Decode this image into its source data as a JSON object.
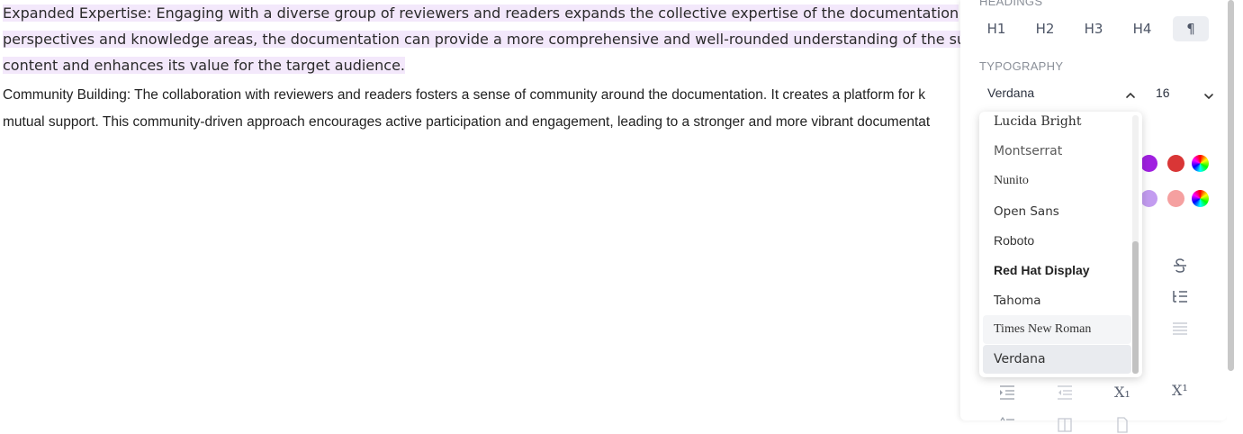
{
  "document": {
    "para1_lines": [
      "Expanded Expertise: Engaging with a diverse group of reviewers and readers expands the collective expertise of the documentation",
      "perspectives and knowledge areas, the documentation can provide a more comprehensive and well-rounded understanding of the su",
      "content and enhances its value for the target audience."
    ],
    "para2_lines": [
      "Community Building: The collaboration with reviewers and readers fosters a sense of community around the documentation. It creates a platform for k",
      "mutual support. This community-driven approach encourages active participation and engagement, leading to a stronger and more vibrant documentat"
    ]
  },
  "panel": {
    "headings_label": "HEADINGS",
    "headings": [
      "H1",
      "H2",
      "H3",
      "H4",
      "¶"
    ],
    "typography_label": "TYPOGRAPHY",
    "font_value": "Verdana",
    "size_value": "16",
    "subscript_label": "X₁",
    "superscript_label": "X¹"
  },
  "dropdown": {
    "options": [
      "Lucida Bright",
      "Montserrat",
      "Nunito",
      "Open Sans",
      "Roboto",
      "Red Hat Display",
      "Tahoma",
      "Times New Roman",
      "Verdana"
    ],
    "selected": "Verdana",
    "hovered": "Times New Roman"
  },
  "colors": {
    "highlight": "#f3e8fb",
    "swatches_row1": [
      "#a020e0",
      "#d93636"
    ],
    "swatches_row2": [
      "#c39cf0",
      "#f5a0a0"
    ]
  }
}
